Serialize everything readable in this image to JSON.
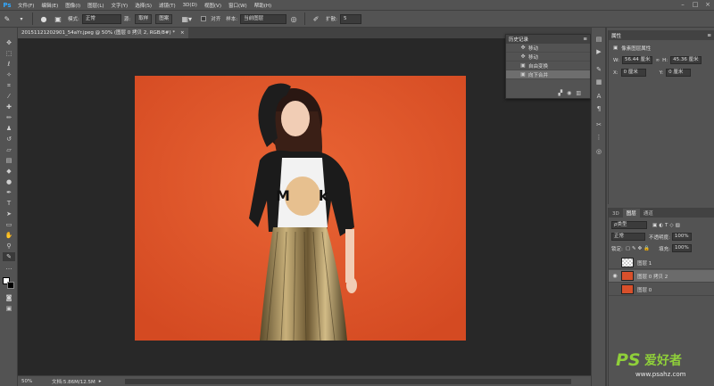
{
  "app": {
    "logo": "Ps"
  },
  "menu": [
    "文件(F)",
    "编辑(E)",
    "图像(I)",
    "图层(L)",
    "文字(Y)",
    "选择(S)",
    "滤镜(T)",
    "3D(D)",
    "视图(V)",
    "窗口(W)",
    "帮助(H)"
  ],
  "options": {
    "mode_label": "模式:",
    "mode_value": "正常",
    "source_label": "源:",
    "source_btn": "取样",
    "pattern_btn": "图案",
    "aligned_label": "对齐",
    "sample_label": "样本:",
    "sample_value": "当前图层",
    "diffusion_label": "扩散:",
    "diffusion_value": "5"
  },
  "document": {
    "tab_title": "20151121202901_54aYr.jpeg @ 50% (图层 0 拷贝 2, RGB/8#) *"
  },
  "history": {
    "title": "历史记录",
    "items": [
      "移动",
      "移动",
      "自由变换",
      "向下合并"
    ]
  },
  "properties": {
    "title": "属性",
    "section": "像素图层属性",
    "w_label": "W:",
    "w_value": "56.44 厘米",
    "h_label": "H:",
    "h_value": "45.36 厘米",
    "x_label": "X:",
    "x_value": "0 厘米",
    "y_label": "Y:",
    "y_value": "0 厘米"
  },
  "layers": {
    "tabs": [
      "3D",
      "图层",
      "通道"
    ],
    "kind_label": "ρ类型",
    "blend": "正常",
    "opacity_label": "不透明度:",
    "opacity_value": "100%",
    "lock_label": "锁定:",
    "fill_label": "填充:",
    "fill_value": "100%",
    "items": [
      {
        "name": "图层 1",
        "visible": false
      },
      {
        "name": "图层 0 拷贝 2",
        "visible": true
      },
      {
        "name": "图层 0",
        "visible": false
      }
    ]
  },
  "status": {
    "zoom": "50%",
    "doc_info": "文档:5.86M/12.5M"
  },
  "watermark": {
    "logo": "PS爱好者",
    "url": "www.psahz.com"
  },
  "colors": {
    "accent": "#31a8ff",
    "background_orange": "#e0582e"
  }
}
